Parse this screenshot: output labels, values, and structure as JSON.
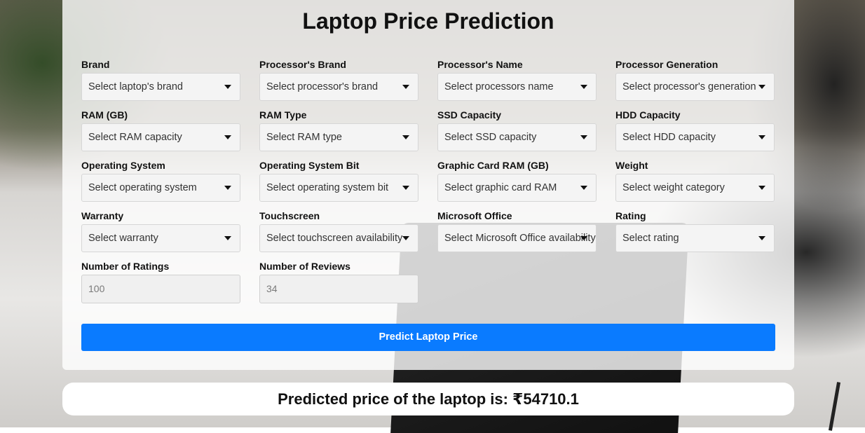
{
  "title": "Laptop Price Prediction",
  "fields": [
    {
      "label": "Brand",
      "placeholder": "Select laptop's brand"
    },
    {
      "label": "Processor's Brand",
      "placeholder": "Select processor's brand"
    },
    {
      "label": "Processor's Name",
      "placeholder": "Select processors name"
    },
    {
      "label": "Processor Generation",
      "placeholder": "Select processor's generation"
    },
    {
      "label": "RAM (GB)",
      "placeholder": "Select RAM capacity"
    },
    {
      "label": "RAM Type",
      "placeholder": "Select RAM type"
    },
    {
      "label": "SSD Capacity",
      "placeholder": "Select SSD capacity"
    },
    {
      "label": "HDD Capacity",
      "placeholder": "Select HDD capacity"
    },
    {
      "label": "Operating System",
      "placeholder": "Select operating system"
    },
    {
      "label": "Operating System Bit",
      "placeholder": "Select operating system bit"
    },
    {
      "label": "Graphic Card RAM (GB)",
      "placeholder": "Select graphic card RAM"
    },
    {
      "label": "Weight",
      "placeholder": "Select weight category"
    },
    {
      "label": "Warranty",
      "placeholder": "Select warranty"
    },
    {
      "label": "Touchscreen",
      "placeholder": "Select touchscreen availability"
    },
    {
      "label": "Microsoft Office",
      "placeholder": "Select Microsoft Office availability"
    },
    {
      "label": "Rating",
      "placeholder": "Select rating"
    }
  ],
  "inputs": [
    {
      "label": "Number of Ratings",
      "value": "100"
    },
    {
      "label": "Number of Reviews",
      "value": "34"
    }
  ],
  "predict_button": "Predict Laptop Price",
  "result_text": "Predicted price of the laptop is: ₹54710.1",
  "colors": {
    "button": "#0a7bff",
    "card": "#ffffff"
  }
}
